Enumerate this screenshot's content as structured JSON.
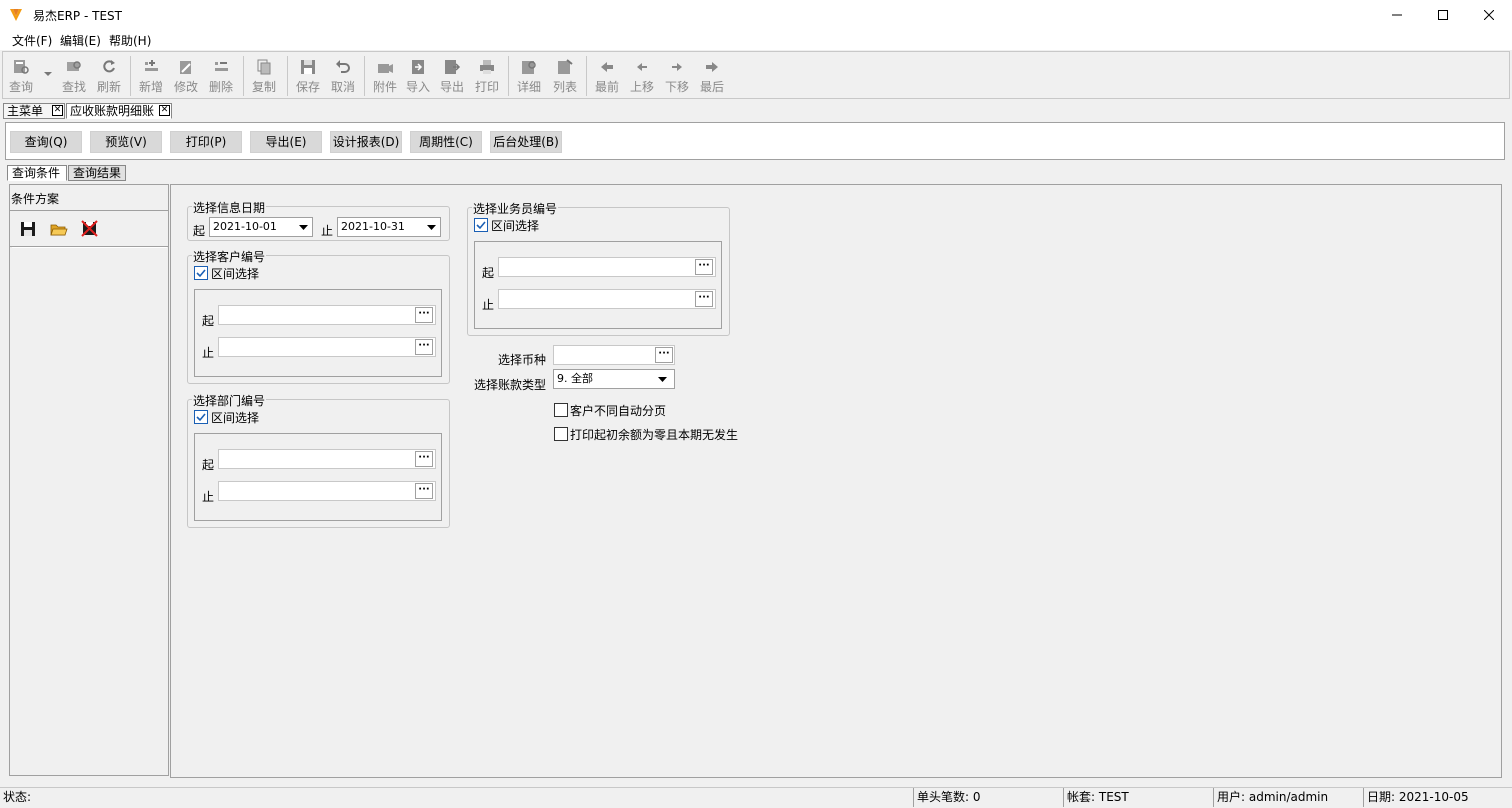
{
  "window": {
    "title": "易杰ERP - TEST",
    "min_label": "—",
    "max_label": "☐",
    "close_label": "✕"
  },
  "menu": [
    "文件(F)",
    "编辑(E)",
    "帮助(H)"
  ],
  "toolbar": {
    "query": "查询",
    "find": "查找",
    "refresh": "刷新",
    "add": "新增",
    "edit": "修改",
    "delete": "删除",
    "copy": "复制",
    "save": "保存",
    "cancel": "取消",
    "attach": "附件",
    "import": "导入",
    "export": "导出",
    "print": "打印",
    "detail": "详细",
    "list": "列表",
    "first": "最前",
    "up": "上移",
    "down": "下移",
    "last": "最后"
  },
  "doc_tabs": [
    "主菜单",
    "应收账款明细账"
  ],
  "actions": [
    "查询(Q)",
    "预览(V)",
    "打印(P)",
    "导出(E)",
    "设计报表(D)",
    "周期性(C)",
    "后台处理(B)"
  ],
  "sub_tabs": [
    "查询条件",
    "查询结果"
  ],
  "left": {
    "title": "条件方案"
  },
  "date_group": {
    "title": "选择信息日期",
    "from_label": "起",
    "to_label": "止",
    "from_value": "2021-10-01",
    "to_value": "2021-10-31"
  },
  "customer_group": {
    "title": "选择客户编号",
    "range_label": "区间选择",
    "range_checked": true,
    "from_label": "起",
    "to_label": "止"
  },
  "dept_group": {
    "title": "选择部门编号",
    "range_label": "区间选择",
    "range_checked": true,
    "from_label": "起",
    "to_label": "止"
  },
  "salesman_group": {
    "title": "选择业务员编号",
    "range_label": "区间选择",
    "range_checked": true,
    "from_label": "起",
    "to_label": "止"
  },
  "currency": {
    "label": "选择币种",
    "value": ""
  },
  "account_type": {
    "label": "选择账款类型",
    "value": "9. 全部"
  },
  "options": {
    "auto_page": "客户不同自动分页",
    "print_zero": "打印起初余额为零且本期无发生"
  },
  "ellipsis": "···",
  "status": {
    "state": "状态:",
    "count": "单头笔数: 0",
    "account": "帐套: TEST",
    "user": "用户: admin/admin",
    "date": "日期: 2021-10-05"
  },
  "colors": {
    "check_blue": "#1a5fb4",
    "toolbar_disabled": "#8a8a8a",
    "app_icon": "#f39c12"
  }
}
